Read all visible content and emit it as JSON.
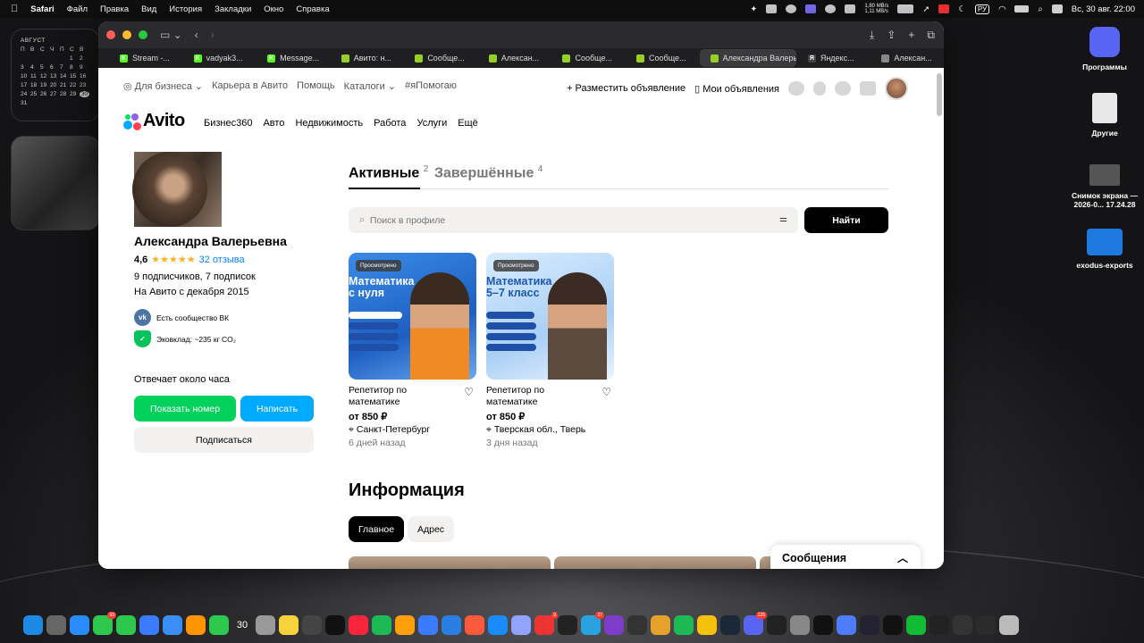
{
  "menubar": {
    "apple": "",
    "app": "Safari",
    "items": [
      "Файл",
      "Правка",
      "Вид",
      "История",
      "Закладки",
      "Окно",
      "Справка"
    ],
    "speed_up": "1,80 MB/s",
    "speed_down": "1,11 MB/s",
    "lang": "РУ",
    "datetime": "Вс, 30 авг.  22:00"
  },
  "calendar": {
    "month": "АВГУСТ",
    "weekdays": [
      "П",
      "В",
      "С",
      "Ч",
      "П",
      "С",
      "В"
    ],
    "rows": [
      [
        "",
        "",
        "",
        "",
        "",
        "1",
        "2"
      ],
      [
        "3",
        "4",
        "5",
        "6",
        "7",
        "8",
        "9"
      ],
      [
        "10",
        "11",
        "12",
        "13",
        "14",
        "15",
        "16"
      ],
      [
        "17",
        "18",
        "19",
        "20",
        "21",
        "22",
        "23"
      ],
      [
        "24",
        "25",
        "26",
        "27",
        "28",
        "29",
        "30"
      ],
      [
        "31",
        "",
        "",
        "",
        "",
        "",
        ""
      ]
    ],
    "today": "30"
  },
  "desktop": {
    "icons": [
      {
        "label": "Программы",
        "color": "#5865f2"
      },
      {
        "label": "Другие",
        "color": "#e8e8e8"
      },
      {
        "label": "Снимок экрана — 2026-0... 17.24.28",
        "color": "#555"
      },
      {
        "label": "exodus-exports",
        "color": "#1f7ae0"
      }
    ]
  },
  "browser": {
    "tabs": [
      {
        "label": "Stream -...",
        "icon": "K",
        "color": "#53fc18"
      },
      {
        "label": "vadyak3...",
        "icon": "K",
        "color": "#53fc18"
      },
      {
        "label": "Message...",
        "icon": "K",
        "color": "#53fc18"
      },
      {
        "label": "Авито: н...",
        "icon": "",
        "color": "#97cf26"
      },
      {
        "label": "Сообще...",
        "icon": "",
        "color": "#97cf26"
      },
      {
        "label": "Алексан...",
        "icon": "",
        "color": "#97cf26"
      },
      {
        "label": "Сообще...",
        "icon": "",
        "color": "#97cf26"
      },
      {
        "label": "Сообще...",
        "icon": "",
        "color": "#97cf26"
      },
      {
        "label": "Александра Валерь...",
        "icon": "",
        "color": "#97cf26",
        "active": true
      },
      {
        "label": "Яндекс...",
        "icon": "Я",
        "color": "#444"
      },
      {
        "label": "Алексан...",
        "icon": "",
        "color": "#888"
      }
    ]
  },
  "header": {
    "for_business": "Для бизнеса",
    "career": "Карьера в Авито",
    "help": "Помощь",
    "catalogs": "Каталоги",
    "ipomogayu": "#яПомогаю",
    "post_ad": "Разместить объявление",
    "my_ads": "Мои объявления",
    "logo": "Avito",
    "nav": [
      "Бизнес360",
      "Авто",
      "Недвижимость",
      "Работа",
      "Услуги",
      "Ещё"
    ]
  },
  "profile": {
    "name": "Александра Валерьевна",
    "rating": "4,6",
    "stars": "★★★★★",
    "reviews": "32 отзыва",
    "subscribers": "9 подписчиков, 7 подписок",
    "since": "На Авито с декабря 2015",
    "badge_vk": "Есть сообщество ВК",
    "badge_eco": "Эковклад: ~235 кг CO₂",
    "response": "Отвечает около часа",
    "show_number": "Показать номер",
    "write": "Написать",
    "subscribe": "Подписаться"
  },
  "listings": {
    "tab_active": "Активные",
    "tab_active_count": "2",
    "tab_done": "Завершённые",
    "tab_done_count": "4",
    "search_placeholder": "Поиск в профиле",
    "search_button": "Найти",
    "items": [
      {
        "seen": "Просмотрено",
        "image_title": "Математика с нуля",
        "image_sub": "Подготовка к ОГЭ",
        "bullets": [
          "Простое объяснение",
          "Чёткий план",
          "Результат гарантирую"
        ],
        "title": "Репетитор по математике",
        "price": "от 850 ₽",
        "location": "Санкт-Петербург",
        "ago": "6 дней назад"
      },
      {
        "seen": "Просмотрено",
        "image_title": "Математика 5–7 класс",
        "image_sub": "летние занятия",
        "bullets": [
          "устранение пробелов",
          "повышение успеваемости",
          "онлайн занятия"
        ],
        "title": "Репетитор по математике",
        "price": "от 850 ₽",
        "location": "Тверская обл., Тверь",
        "ago": "3 дня назад"
      }
    ]
  },
  "info": {
    "title": "Информация",
    "tab_main": "Главное",
    "tab_address": "Адрес"
  },
  "messages": {
    "label": "Сообщения"
  },
  "dock": {
    "calendar_day": "30",
    "badges": {
      "messages": "93",
      "app13": "9",
      "app15": "37",
      "discord": "126"
    }
  }
}
